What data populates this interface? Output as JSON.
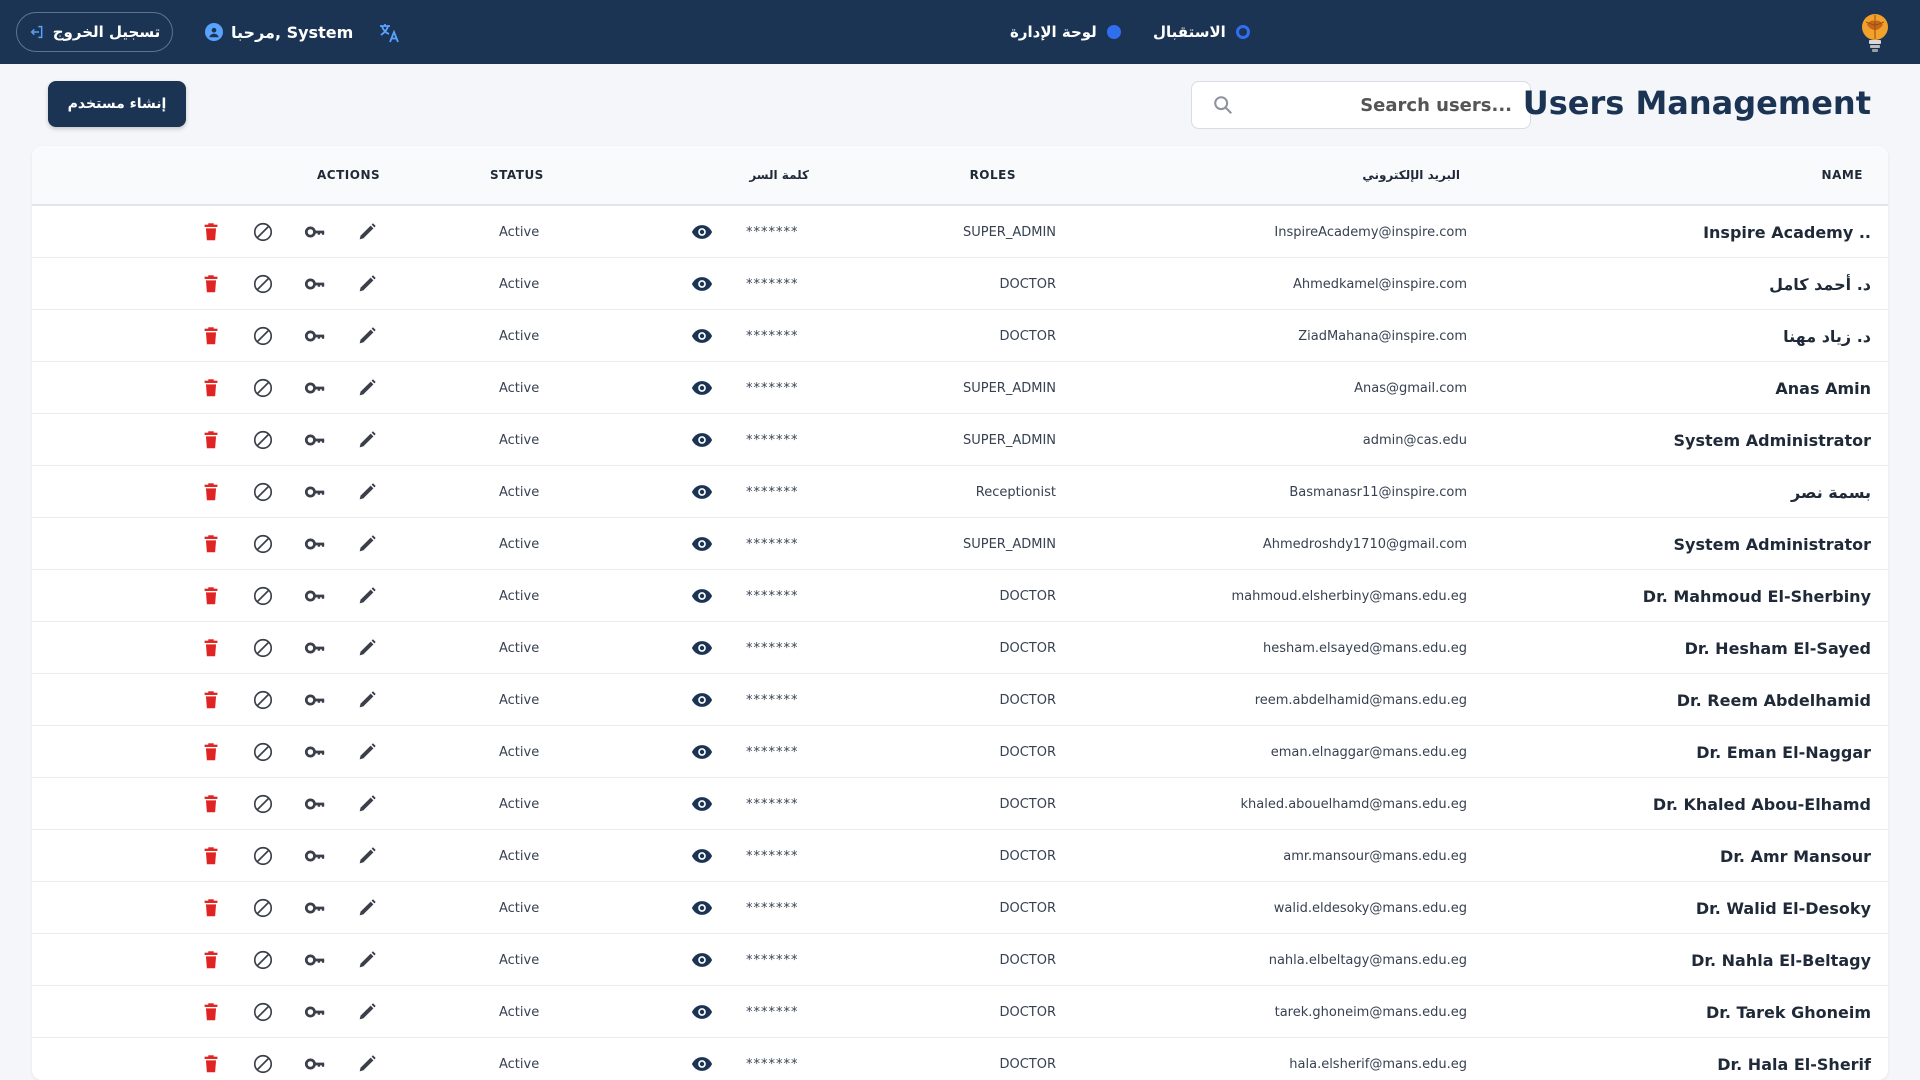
{
  "topbar": {
    "logout_label": "تسجيل الخروج",
    "welcome_label": "مرحبا, System",
    "nav_dashboard": "لوحة الإدارة",
    "nav_reception": "الاستقبال"
  },
  "header": {
    "title": "Users Management",
    "search_placeholder": "Search users...",
    "create_button": "إنشاء مستخدم"
  },
  "table": {
    "columns": {
      "name": "NAME",
      "email": "البريد الإلكتروني",
      "roles": "ROLES",
      "password": "كلمة السر",
      "status": "STATUS",
      "actions": "ACTIONS"
    },
    "rows": [
      {
        "name": "Inspire Academy ..",
        "email": "InspireAcademy@inspire.com",
        "role": "SUPER_ADMIN",
        "password": "*******",
        "status": "Active"
      },
      {
        "name": "د. أحمد كامل",
        "email": "Ahmedkamel@inspire.com",
        "role": "DOCTOR",
        "password": "*******",
        "status": "Active"
      },
      {
        "name": "د. زياد مهنا",
        "email": "ZiadMahana@inspire.com",
        "role": "DOCTOR",
        "password": "*******",
        "status": "Active"
      },
      {
        "name": "Anas Amin",
        "email": "Anas@gmail.com",
        "role": "SUPER_ADMIN",
        "password": "*******",
        "status": "Active"
      },
      {
        "name": "System Administrator",
        "email": "admin@cas.edu",
        "role": "SUPER_ADMIN",
        "password": "*******",
        "status": "Active"
      },
      {
        "name": "بسمة نصر",
        "email": "Basmanasr11@inspire.com",
        "role": "Receptionist",
        "password": "*******",
        "status": "Active"
      },
      {
        "name": "System Administrator",
        "email": "Ahmedroshdy1710@gmail.com",
        "role": "SUPER_ADMIN",
        "password": "*******",
        "status": "Active"
      },
      {
        "name": "Dr. Mahmoud El-Sherbiny",
        "email": "mahmoud.elsherbiny@mans.edu.eg",
        "role": "DOCTOR",
        "password": "*******",
        "status": "Active"
      },
      {
        "name": "Dr. Hesham El-Sayed",
        "email": "hesham.elsayed@mans.edu.eg",
        "role": "DOCTOR",
        "password": "*******",
        "status": "Active"
      },
      {
        "name": "Dr. Reem Abdelhamid",
        "email": "reem.abdelhamid@mans.edu.eg",
        "role": "DOCTOR",
        "password": "*******",
        "status": "Active"
      },
      {
        "name": "Dr. Eman El-Naggar",
        "email": "eman.elnaggar@mans.edu.eg",
        "role": "DOCTOR",
        "password": "*******",
        "status": "Active"
      },
      {
        "name": "Dr. Khaled Abou-Elhamd",
        "email": "khaled.abouelhamd@mans.edu.eg",
        "role": "DOCTOR",
        "password": "*******",
        "status": "Active"
      },
      {
        "name": "Dr. Amr Mansour",
        "email": "amr.mansour@mans.edu.eg",
        "role": "DOCTOR",
        "password": "*******",
        "status": "Active"
      },
      {
        "name": "Dr. Walid El-Desoky",
        "email": "walid.eldesoky@mans.edu.eg",
        "role": "DOCTOR",
        "password": "*******",
        "status": "Active"
      },
      {
        "name": "Dr. Nahla El-Beltagy",
        "email": "nahla.elbeltagy@mans.edu.eg",
        "role": "DOCTOR",
        "password": "*******",
        "status": "Active"
      },
      {
        "name": "Dr. Tarek Ghoneim",
        "email": "tarek.ghoneim@mans.edu.eg",
        "role": "DOCTOR",
        "password": "*******",
        "status": "Active"
      },
      {
        "name": "Dr. Hala El-Sherif",
        "email": "hala.elsherif@mans.edu.eg",
        "role": "DOCTOR",
        "password": "*******",
        "status": "Active"
      }
    ]
  },
  "icons": {
    "eye": "eye-icon",
    "edit": "pencil-icon",
    "key": "key-icon",
    "ban": "ban-icon",
    "delete": "trash-icon"
  },
  "colors": {
    "navy": "#1b3454",
    "accent_blue": "#2f6ff0",
    "delete_red": "#e02424"
  }
}
